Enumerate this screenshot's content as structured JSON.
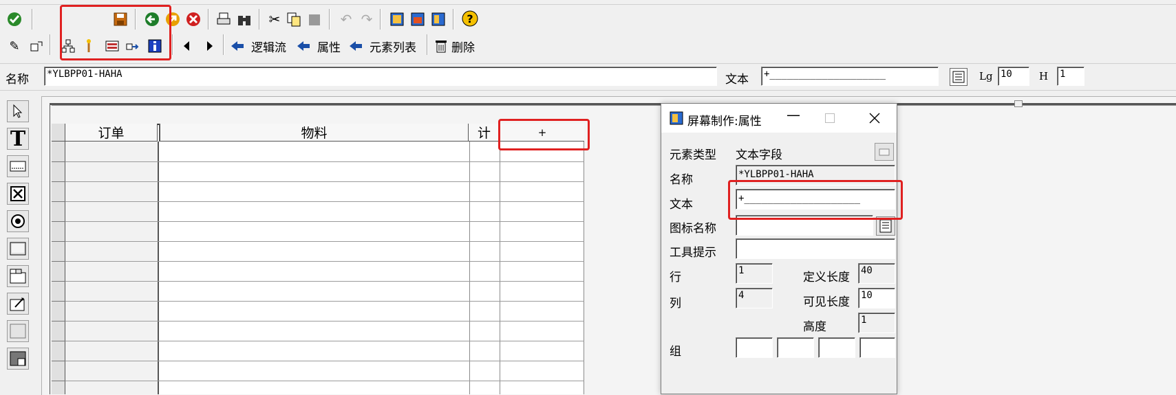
{
  "toolbar1": {
    "icons": [
      "check-icon",
      "save-icon",
      "back-icon",
      "exit-icon",
      "cancel-icon",
      "print-icon",
      "find-icon",
      "cut-icon",
      "copy-icon",
      "paste-icon",
      "undo-icon",
      "redo-icon",
      "layout-icon-1",
      "layout-icon-2",
      "layout-icon-3",
      "help-icon"
    ]
  },
  "toolbar2": {
    "logic_flow_label": "逻辑流",
    "attributes_label": "属性",
    "element_list_label": "元素列表",
    "delete_label": "删除"
  },
  "namebar": {
    "name_label": "名称",
    "name_value": "*YLBPP01-HAHA",
    "text_label": "文本",
    "text_value": "+____________________",
    "lg_label": "Lg",
    "lg_value": "10",
    "h_label": "H",
    "h_value": "1"
  },
  "table": {
    "headers": [
      "订单",
      "物料",
      "计",
      "+"
    ]
  },
  "dialog": {
    "title": "屏幕制作:属性",
    "element_type_label": "元素类型",
    "element_type_value": "文本字段",
    "name_label": "名称",
    "name_value": "*YLBPP01-HAHA",
    "text_label": "文本",
    "text_value": "+____________________",
    "icon_name_label": "图标名称",
    "tooltip_label": "工具提示",
    "row_label": "行",
    "row_value": "1",
    "col_label": "列",
    "col_value": "4",
    "def_len_label": "定义长度",
    "def_len_value": "40",
    "vis_len_label": "可见长度",
    "vis_len_value": "10",
    "height_label": "高度",
    "height_value": "1",
    "group_label": "组"
  },
  "colors": {
    "highlight": "#e02020",
    "icon_blue": "#1a4fa8"
  }
}
